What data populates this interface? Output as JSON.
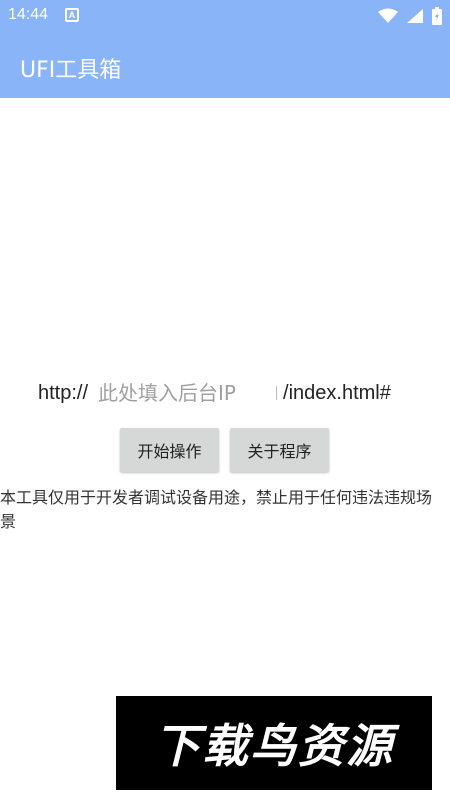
{
  "status_bar": {
    "time": "14:44",
    "notification_icon": "A"
  },
  "app_bar": {
    "title": "UFI工具箱",
    "color": "#8ab4f8"
  },
  "url_row": {
    "prefix": "http://",
    "placeholder": "此处填入后台IP",
    "value": "",
    "suffix": "/index.html#"
  },
  "buttons": {
    "start_label": "开始操作",
    "about_label": "关于程序"
  },
  "disclaimer": "本工具仅用于开发者调试设备用途，禁止用于任何违法违规场景",
  "watermark": {
    "text": "下载鸟资源"
  }
}
